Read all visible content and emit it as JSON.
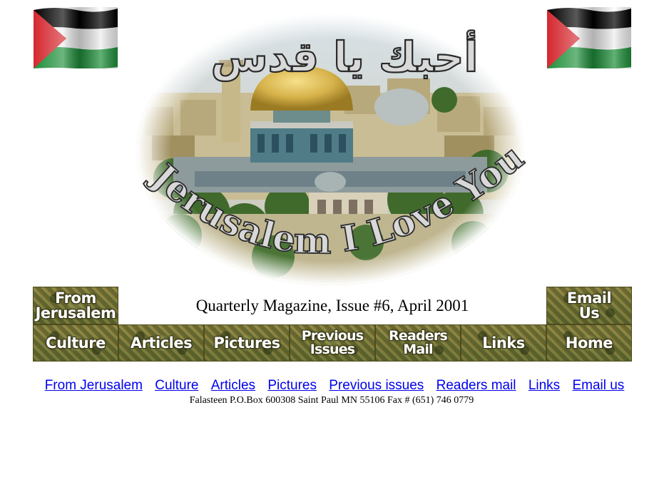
{
  "header": {
    "arabic_title": "أحبك يا قدس",
    "english_title": "Jerusalem I Love You",
    "issue_line": "Quarterly Magazine, Issue #6, April 2001"
  },
  "flag_icon": "palestine-flag",
  "colors": {
    "flag_black": "#000000",
    "flag_white": "#ffffff",
    "flag_green": "#1e8f3a",
    "flag_red": "#d4272e",
    "link": "#0000ee",
    "tile_olive": "#6e6a2a"
  },
  "tiles": {
    "from_jerusalem": [
      "From",
      "Jerusalem"
    ],
    "email_us": [
      "Email",
      "Us"
    ],
    "culture": "Culture",
    "articles": "Articles",
    "pictures": "Pictures",
    "previous_issues": [
      "Previous",
      "Issues"
    ],
    "readers_mail": [
      "Readers",
      "Mail"
    ],
    "links": "Links",
    "home": "Home"
  },
  "text_nav": [
    "From Jerusalem",
    "Culture",
    "Articles",
    "Pictures",
    "Previous issues",
    "Readers mail",
    "Links",
    "Email us"
  ],
  "address": "Falasteen P.O.Box 600308 Saint Paul MN 55106 Fax # (651) 746 0779"
}
